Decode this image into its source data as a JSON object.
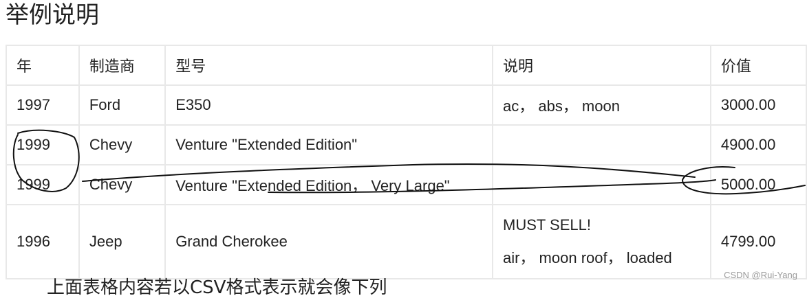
{
  "heading": "举例说明",
  "table": {
    "headers": [
      "年",
      "制造商",
      "型号",
      "说明",
      "价值"
    ],
    "rows": [
      {
        "year": "1997",
        "make": "Ford",
        "model": "E350",
        "description": [
          "ac， abs， moon"
        ],
        "price": "3000.00"
      },
      {
        "year": "1999",
        "make": "Chevy",
        "model": "Venture \"Extended Edition\"",
        "description": [
          ""
        ],
        "price": "4900.00"
      },
      {
        "year": "1999",
        "make": "Chevy",
        "model": "Venture \"Extended Edition， Very Large\"",
        "description": [
          ""
        ],
        "price": "5000.00"
      },
      {
        "year": "1996",
        "make": "Jeep",
        "model": "Grand Cherokee",
        "description": [
          "MUST SELL!",
          "air， moon roof， loaded"
        ],
        "price": "4799.00"
      }
    ]
  },
  "next_line_text": "上面表格内容若以CSV格式表示就会像下列",
  "watermark": "CSDN @Rui-Yang",
  "annotation_color": "#111111"
}
